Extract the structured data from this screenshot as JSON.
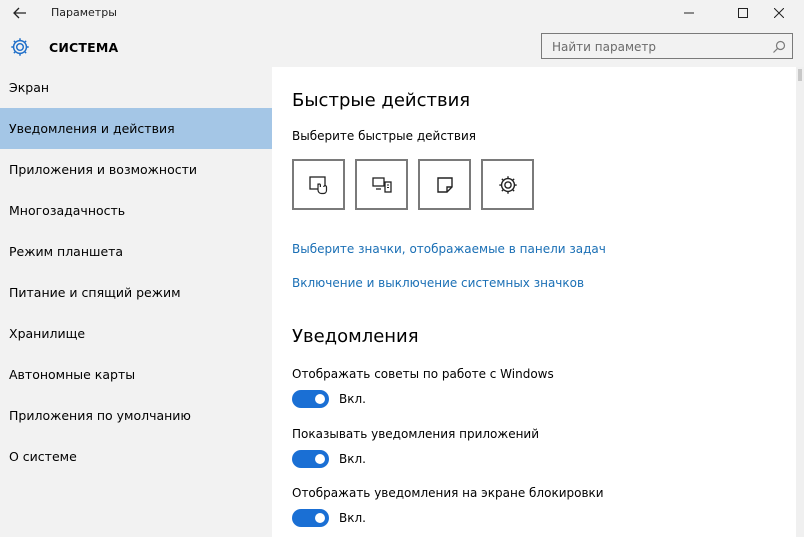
{
  "window": {
    "title": "Параметры",
    "icons": {
      "back": "back-arrow-icon",
      "minimize": "minimize-icon",
      "maximize": "maximize-icon",
      "close": "close-icon"
    }
  },
  "header": {
    "icon": "gear-icon",
    "title": "СИСТЕМА",
    "search_placeholder": "Найти параметр",
    "search_icon": "search-icon"
  },
  "sidebar": {
    "items": [
      {
        "label": "Экран"
      },
      {
        "label": "Уведомления и действия",
        "selected": true
      },
      {
        "label": "Приложения и возможности"
      },
      {
        "label": "Многозадачность"
      },
      {
        "label": "Режим планшета"
      },
      {
        "label": "Питание и спящий режим"
      },
      {
        "label": "Хранилище"
      },
      {
        "label": "Автономные карты"
      },
      {
        "label": "Приложения по умолчанию"
      },
      {
        "label": "О системе"
      }
    ]
  },
  "main": {
    "quick_actions": {
      "heading": "Быстрые действия",
      "subtitle": "Выберите быстрые действия",
      "tiles": [
        {
          "icon": "tablet-mode-icon"
        },
        {
          "icon": "connect-display-icon"
        },
        {
          "icon": "note-icon"
        },
        {
          "icon": "settings-gear-icon"
        }
      ]
    },
    "links": {
      "taskbar_icons": "Выберите значки, отображаемые в панели задач",
      "system_icons": "Включение и выключение системных значков"
    },
    "notifications": {
      "heading": "Уведомления",
      "settings": [
        {
          "label": "Отображать советы по работе с Windows",
          "state": "Вкл.",
          "on": true
        },
        {
          "label": "Показывать уведомления приложений",
          "state": "Вкл.",
          "on": true
        },
        {
          "label": "Отображать уведомления на экране блокировки",
          "state": "Вкл.",
          "on": true
        }
      ]
    }
  },
  "colors": {
    "chrome": "#f2f2f2",
    "selected": "#a4c6e6",
    "link": "#1a6fb5",
    "toggle_on": "#1a6fd4"
  }
}
